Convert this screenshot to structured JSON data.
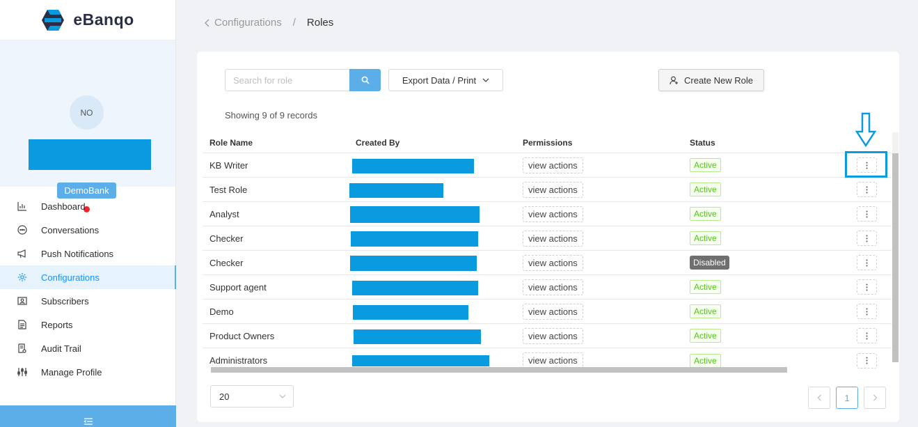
{
  "brand": {
    "name": "eBanqo"
  },
  "profile": {
    "initials": "NO",
    "bank": "DemoBank"
  },
  "nav": {
    "items": [
      {
        "label": "Dashboard"
      },
      {
        "label": "Conversations"
      },
      {
        "label": "Push Notifications"
      },
      {
        "label": "Configurations",
        "active": true
      },
      {
        "label": "Subscribers"
      },
      {
        "label": "Reports"
      },
      {
        "label": "Audit Trail"
      },
      {
        "label": "Manage Profile"
      }
    ]
  },
  "breadcrumb": {
    "parent": "Configurations",
    "separator": "/",
    "current": "Roles"
  },
  "toolbar": {
    "search_placeholder": "Search for role",
    "export_label": "Export Data / Print",
    "create_label": "Create New Role"
  },
  "records_text": "Showing 9 of 9 records",
  "table": {
    "headers": {
      "name": "Role Name",
      "created": "Created By",
      "permissions": "Permissions",
      "status": "Status"
    },
    "rows": [
      {
        "name": "KB Writer",
        "permissions": "view actions",
        "status": "Active"
      },
      {
        "name": "Test Role",
        "permissions": "view actions",
        "status": "Active"
      },
      {
        "name": "Analyst",
        "permissions": "view actions",
        "status": "Active"
      },
      {
        "name": "Checker",
        "permissions": "view actions",
        "status": "Active"
      },
      {
        "name": "Checker",
        "permissions": "view actions",
        "status": "Disabled"
      },
      {
        "name": "Support agent",
        "permissions": "view actions",
        "status": "Active"
      },
      {
        "name": "Demo",
        "permissions": "view actions",
        "status": "Active"
      },
      {
        "name": "Product Owners",
        "permissions": "view actions",
        "status": "Active"
      },
      {
        "name": "Administrators",
        "permissions": "view actions",
        "status": "Active"
      }
    ]
  },
  "pagination": {
    "page_size": "20",
    "current_page": "1"
  },
  "colors": {
    "accent": "#5caee8",
    "redaction": "#0a9ae0",
    "active_green": "#52c41a",
    "disabled_gray": "#6f6f6f"
  }
}
